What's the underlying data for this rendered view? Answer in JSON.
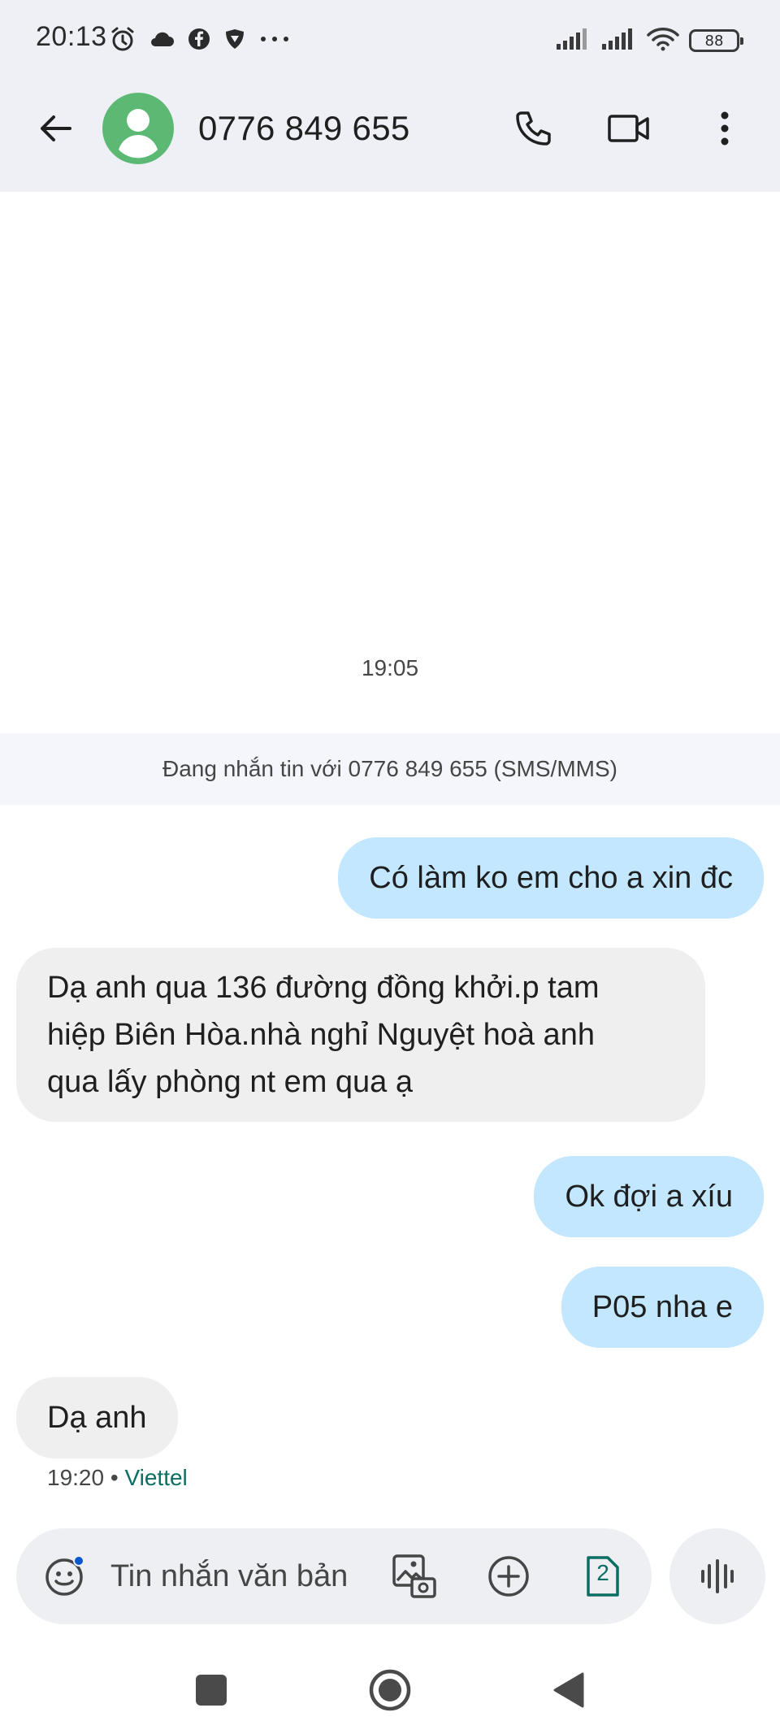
{
  "status_bar": {
    "time": "20:13",
    "battery": "88",
    "icons_left": [
      "alarm-icon",
      "cloud-icon",
      "facebook-icon",
      "shield-icon",
      "more-dots-icon"
    ],
    "icons_right": [
      "signal-sim1-icon",
      "signal-sim2-icon",
      "wifi-icon",
      "battery-icon"
    ]
  },
  "header": {
    "title": "0776 849 655",
    "back_icon": "arrow-back-icon",
    "actions": [
      "phone-icon",
      "video-call-icon",
      "more-vert-icon"
    ],
    "avatar_color": "#5bb974"
  },
  "conversation": {
    "timestamp": "19:05",
    "info_banner": "Đang nhắn tin với 0776 849 655 (SMS/MMS)",
    "messages": [
      {
        "direction": "sent",
        "lines": [
          "Có làm ko em cho a xin đc"
        ]
      },
      {
        "direction": "received",
        "lines": [
          "Dạ anh qua 136 đường đồng khởi.p tam",
          "hiệp Biên Hòa.nhà nghỉ Nguyệt hoà anh",
          "qua lấy phòng nt em qua ạ"
        ]
      },
      {
        "direction": "sent",
        "lines": [
          "Ok đợi a xíu"
        ]
      },
      {
        "direction": "sent",
        "lines": [
          "P05 nha e"
        ]
      },
      {
        "direction": "received",
        "lines": [
          "Dạ anh"
        ]
      }
    ],
    "last_meta": {
      "time": "19:20",
      "separator": "•",
      "carrier": "Viettel"
    }
  },
  "compose": {
    "placeholder": "Tin nhắn văn bản",
    "sim_number": "2",
    "buttons": [
      "emoji-icon",
      "gallery-icon",
      "add-icon",
      "sim-icon",
      "voice-icon"
    ]
  },
  "nav_bar": {
    "buttons": [
      "recents-icon",
      "home-icon",
      "back-triangle-icon"
    ]
  },
  "colors": {
    "header_bg": "#eef0f6",
    "sent_bubble": "#c2e7ff",
    "received_bubble": "#efefef",
    "carrier_text": "#0b6e63",
    "accent": "#0b57d0"
  }
}
